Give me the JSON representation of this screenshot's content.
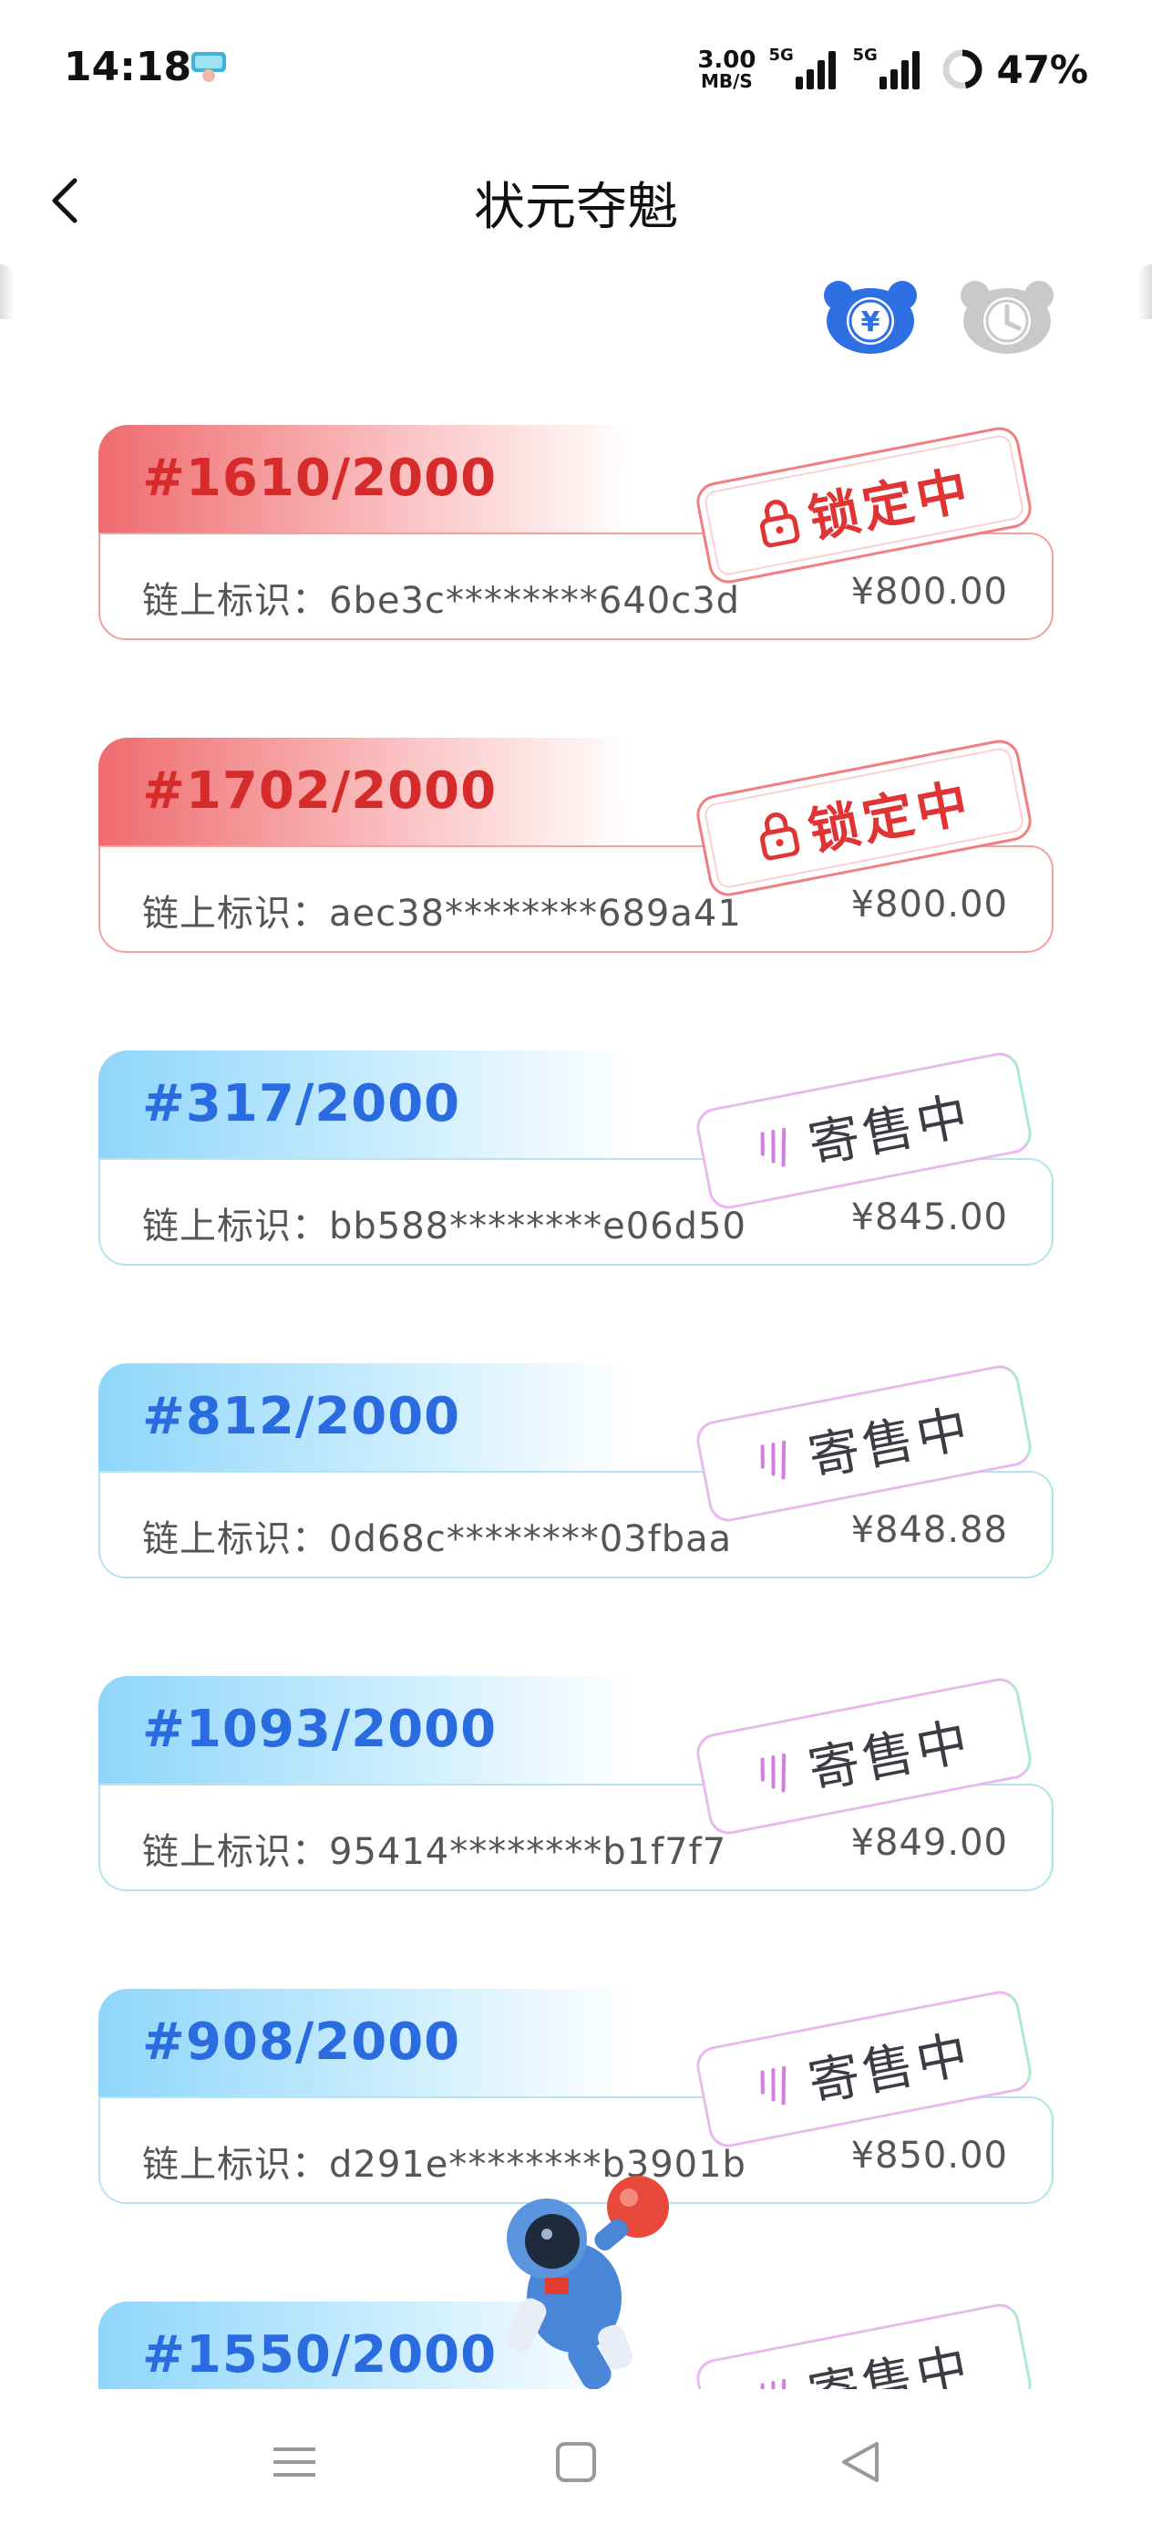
{
  "status_bar": {
    "time": "14:18",
    "net_speed_value": "3.00",
    "net_speed_unit": "MB/S",
    "signal1_tag": "5G",
    "signal2_tag": "5G",
    "battery_percent": "47%"
  },
  "header": {
    "title": "状元夺魁",
    "back_icon": "chevron-left-icon"
  },
  "sort": {
    "price_icon": "yuan-bear-icon",
    "price_active": true,
    "time_icon": "clock-bear-icon",
    "time_active": false
  },
  "colors": {
    "locked_red": "#e03434",
    "consign_blue": "#2a6be0",
    "active_sort_blue": "#2f6fe4",
    "inactive_sort_grey": "#c9c9c9"
  },
  "items": [
    {
      "edition": "#1610/2000",
      "chain_label": "链上标识：",
      "chain_id": "6be3c********640c3d",
      "price": "¥800.00",
      "status": "锁定中",
      "state": "locked"
    },
    {
      "edition": "#1702/2000",
      "chain_label": "链上标识：",
      "chain_id": "aec38********689a41",
      "price": "¥800.00",
      "status": "锁定中",
      "state": "locked"
    },
    {
      "edition": "#317/2000",
      "chain_label": "链上标识：",
      "chain_id": "bb588********e06d50",
      "price": "¥845.00",
      "status": "寄售中",
      "state": "consign"
    },
    {
      "edition": "#812/2000",
      "chain_label": "链上标识：",
      "chain_id": "0d68c********03fbaa",
      "price": "¥848.88",
      "status": "寄售中",
      "state": "consign"
    },
    {
      "edition": "#1093/2000",
      "chain_label": "链上标识：",
      "chain_id": "95414********b1f7f7",
      "price": "¥849.00",
      "status": "寄售中",
      "state": "consign"
    },
    {
      "edition": "#908/2000",
      "chain_label": "链上标识：",
      "chain_id": "d291e********b3901b",
      "price": "¥850.00",
      "status": "寄售中",
      "state": "consign"
    },
    {
      "edition": "#1550/2000",
      "status": "寄售中",
      "state": "consign"
    }
  ],
  "floating": {
    "icon": "astronaut-icon"
  },
  "nav_bar": {
    "menu_icon": "menu-icon",
    "home_icon": "home-square-icon",
    "back_icon": "back-triangle-icon"
  }
}
